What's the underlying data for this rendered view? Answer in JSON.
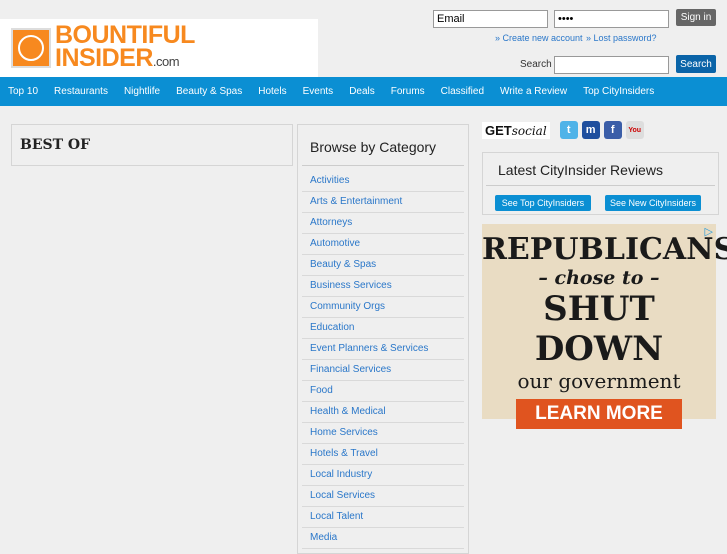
{
  "logo": {
    "line1": "BOUNTIFUL",
    "line2": "INSIDER",
    ".com": ".com"
  },
  "login": {
    "email_value": "Email",
    "password_value": "••••",
    "signin_label": "Sign in",
    "create_account": "» Create new account",
    "lost_password": "» Lost password?"
  },
  "search": {
    "label": "Search",
    "value": "",
    "button": "Search"
  },
  "nav": [
    "Top 10",
    "Restaurants",
    "Nightlife",
    "Beauty & Spas",
    "Hotels",
    "Events",
    "Deals",
    "Forums",
    "Classified",
    "Write a Review",
    "Top CityInsiders"
  ],
  "best_of": "BEST OF",
  "browse": {
    "title": "Browse by Category",
    "items": [
      "Activities",
      "Arts & Entertainment",
      "Attorneys",
      "Automotive",
      "Beauty & Spas",
      "Business Services",
      "Community Orgs",
      "Education",
      "Event Planners & Services",
      "Financial Services",
      "Food",
      "Health & Medical",
      "Home Services",
      "Hotels & Travel",
      "Local Industry",
      "Local Services",
      "Local Talent",
      "Media"
    ]
  },
  "social": {
    "get": "GET",
    "social": "social"
  },
  "reviews": {
    "title": "Latest CityInsider Reviews",
    "top_button": "See Top CityInsiders",
    "new_button": "See New CityInsiders"
  },
  "ad": {
    "line1": "REPUBLICANS",
    "line2": "– chose to –",
    "line3": "SHUT DOWN",
    "line4": "our government",
    "cta": "LEARN MORE"
  }
}
